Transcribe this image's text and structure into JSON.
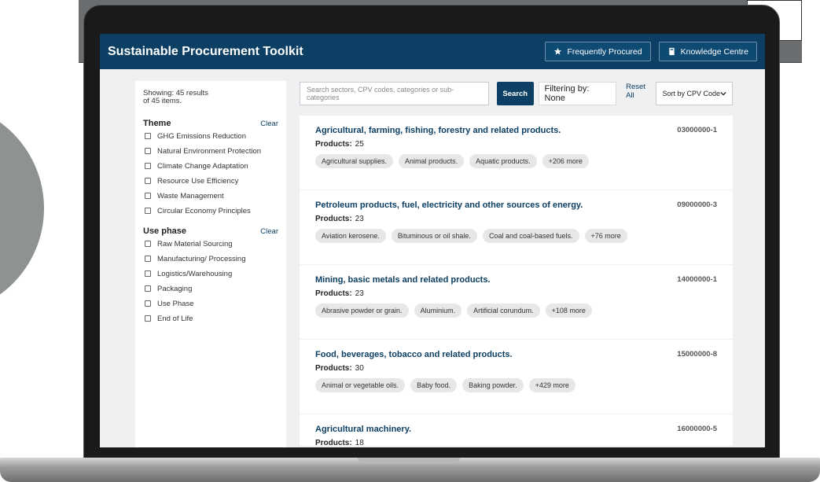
{
  "app": {
    "title": "Sustainable Procurement Toolkit",
    "frequently_procured": "Frequently Procured",
    "knowledge_centre": "Knowledge Centre"
  },
  "sidebar": {
    "showing_line1": "Showing: 45 results",
    "showing_line2": "of 45 items.",
    "theme": {
      "label": "Theme",
      "clear": "Clear",
      "options": [
        "GHG Emissions Reduction",
        "Natural Environment Protection",
        "Climate Change Adaptation",
        "Resource Use Efficiency",
        "Waste Management",
        "Circular Economy Principles"
      ]
    },
    "use_phase": {
      "label": "Use phase",
      "clear": "Clear",
      "options": [
        "Raw Material Sourcing",
        "Manufacturing/ Processing",
        "Logistics/Warehousing",
        "Packaging",
        "Use Phase",
        "End of Life"
      ]
    }
  },
  "toolbar": {
    "search_placeholder": "Search sectors, CPV codes, categories or sub-categories",
    "search_button": "Search",
    "filtering": "Filtering by: None",
    "reset_all": "Reset All",
    "sort_value": "Sort by CPV Code"
  },
  "results": [
    {
      "title": "Agricultural, farming, fishing, forestry and related products.",
      "code": "03000000-1",
      "products_label": "Products:",
      "products": "25",
      "tags": [
        "Agricultural supplies.",
        "Animal products.",
        "Aquatic products.",
        "+206 more"
      ]
    },
    {
      "title": "Petroleum products, fuel, electricity and other sources of energy.",
      "code": "09000000-3",
      "products_label": "Products:",
      "products": "23",
      "tags": [
        "Aviation kerosene.",
        "Bituminous or oil shale.",
        "Coal and coal-based fuels.",
        "+76 more"
      ]
    },
    {
      "title": "Mining, basic metals and related products.",
      "code": "14000000-1",
      "products_label": "Products:",
      "products": "23",
      "tags": [
        "Abrasive powder or grain.",
        "Aluminium.",
        "Artificial corundum.",
        "+108 more"
      ]
    },
    {
      "title": "Food, beverages, tobacco and related products.",
      "code": "15000000-8",
      "products_label": "Products:",
      "products": "30",
      "tags": [
        "Animal or vegetable oils.",
        "Baby food.",
        "Baking powder.",
        "+429 more"
      ]
    },
    {
      "title": "Agricultural machinery.",
      "code": "16000000-5",
      "products_label": "Products:",
      "products": "18",
      "tags": []
    }
  ]
}
